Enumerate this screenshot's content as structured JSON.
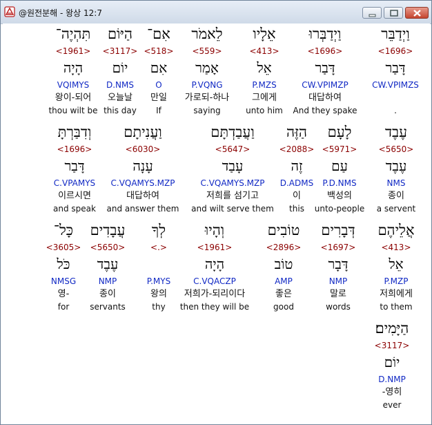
{
  "window": {
    "title": "@원전분해 - 왕상 12:7"
  },
  "colors": {
    "strong": "#8b0000",
    "morph": "#1028c4",
    "titlebar": "#cfdae8"
  },
  "rows": [
    [
      {
        "hebrew": "וַיְדַבֵּר",
        "strong": "<1696>",
        "lemma": "דָּבַר",
        "morph": "CW.VPIMZS",
        "korean": "",
        "english": ".",
        "selected": true
      },
      {
        "hebrew": "וַיְדַבְּרוּ",
        "strong": "<1696>",
        "lemma": "דָּבַר",
        "morph": "CW.VPIMZP",
        "korean": "대답하여",
        "english": "And they spake"
      },
      {
        "hebrew": "אֵלָיו",
        "strong": "<413>",
        "lemma": "אֵל",
        "morph": "P.MZS",
        "korean": "그에게",
        "english": "unto him"
      },
      {
        "hebrew": "לֵאמֹר",
        "strong": "<559>",
        "lemma": "אָמַר",
        "morph": "P.VQNG",
        "korean": "가로되-하나",
        "english": "saying"
      },
      {
        "hebrew": "אִם־",
        "strong": "<518>",
        "lemma": "אִם",
        "morph": "O",
        "korean": "만일",
        "english": "If"
      },
      {
        "hebrew": "הַיּוֹם",
        "strong": "<3117>",
        "lemma": "יוֹם",
        "morph": "D.NMS",
        "korean": "오늘날",
        "english": "this day"
      },
      {
        "hebrew": "תִּהְיֶה־",
        "strong": "<1961>",
        "lemma": "הָיָה",
        "morph": "VQIMYS",
        "korean": "왕이-되어",
        "english": "thou wilt be"
      }
    ],
    [
      {
        "hebrew": "עֶבֶד",
        "strong": "<5650>",
        "lemma": "עֶבֶד",
        "morph": "NMS",
        "korean": "종이",
        "english": "a servent"
      },
      {
        "hebrew": "לָעָם",
        "strong": "<5971>",
        "lemma": "עַם",
        "morph": "P.D.NMS",
        "korean": "백성의",
        "english": "unto-people"
      },
      {
        "hebrew": "הַזֶּה",
        "strong": "<2088>",
        "lemma": "זֶה",
        "morph": "D.ADMS",
        "korean": "이",
        "english": "this"
      },
      {
        "hebrew": "וַעֲבַדְתָּם",
        "strong": "<5647>",
        "lemma": "עָבַד",
        "morph": "C.VQAMYS.MZP",
        "korean": "저희를 섬기고",
        "english": "and wilt serve them"
      },
      {
        "hebrew": "וַעֲנִיתָם",
        "strong": "<6030>",
        "lemma": "עָנָה",
        "morph": "C.VQAMYS.MZP",
        "korean": "대답하여",
        "english": "and answer them"
      },
      {
        "hebrew": "וְדִבַּרְתָּ",
        "strong": "<1696>",
        "lemma": "דָּבַר",
        "morph": "C.VPAMYS",
        "korean": "이르시면",
        "english": "and speak"
      }
    ],
    [
      {
        "hebrew": "אֲלֵיהֶם",
        "strong": "<413>",
        "lemma": "אֵל",
        "morph": "P.MZP",
        "korean": "저희에게",
        "english": "to them"
      },
      {
        "hebrew": "דְּבָרִים",
        "strong": "<1697>",
        "lemma": "דָּבָר",
        "morph": "NMP",
        "korean": "말로",
        "english": "words"
      },
      {
        "hebrew": "טוֹבִים",
        "strong": "<2896>",
        "lemma": "טוֹב",
        "morph": "AMP",
        "korean": "좋은",
        "english": "good"
      },
      {
        "hebrew": "וְהָיוּ",
        "strong": "<1961>",
        "lemma": "הָיָה",
        "morph": "C.VQACZP",
        "korean": "저희가-되리이다",
        "english": "then they will be"
      },
      {
        "hebrew": "לְךָ",
        "strong": "<.>",
        "lemma": "",
        "morph": "P.MYS",
        "korean": "왕의",
        "english": "thy"
      },
      {
        "hebrew": "עֲבָדִים",
        "strong": "<5650>",
        "lemma": "עֶבֶד",
        "morph": "NMP",
        "korean": "종이",
        "english": "servants"
      },
      {
        "hebrew": "כָּל־",
        "strong": "<3605>",
        "lemma": "כֹּל",
        "morph": "NMSG",
        "korean": "영-",
        "english": "for"
      }
    ],
    [
      {
        "hebrew": "הַיָּמִים׃",
        "strong": "<3117>",
        "lemma": "יוֹם",
        "morph": "D.NMP",
        "korean": "-영히",
        "english": "ever"
      }
    ]
  ]
}
